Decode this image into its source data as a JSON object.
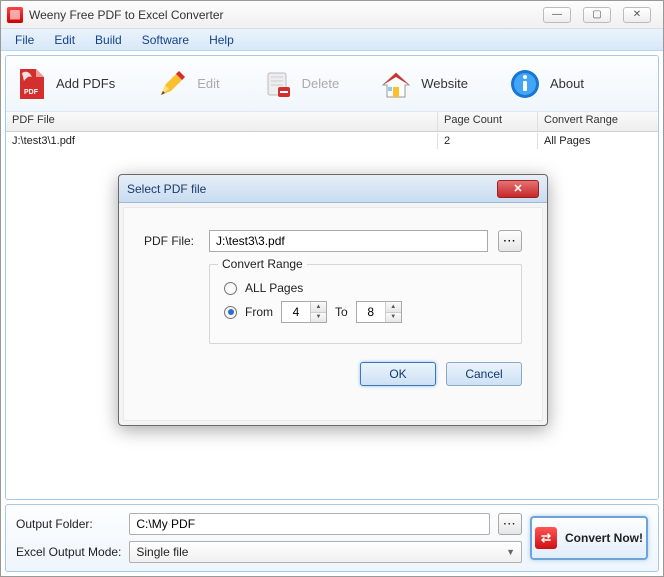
{
  "window": {
    "title": "Weeny Free PDF to Excel Converter",
    "controls": {
      "min": "—",
      "max": "▢",
      "close": "✕"
    }
  },
  "menubar": [
    "File",
    "Edit",
    "Build",
    "Software",
    "Help"
  ],
  "toolbar": {
    "add": "Add PDFs",
    "edit": "Edit",
    "delete": "Delete",
    "website": "Website",
    "about": "About"
  },
  "table": {
    "headers": {
      "file": "PDF File",
      "count": "Page Count",
      "range": "Convert Range"
    },
    "rows": [
      {
        "file": "J:\\test3\\1.pdf",
        "count": "2",
        "range": "All Pages"
      }
    ]
  },
  "bottom": {
    "output_label": "Output Folder:",
    "output_value": "C:\\My PDF",
    "mode_label": "Excel Output Mode:",
    "mode_value": "Single file",
    "convert": "Convert Now!"
  },
  "dialog": {
    "title": "Select PDF file",
    "file_label": "PDF File:",
    "file_value": "J:\\test3\\3.pdf",
    "range_legend": "Convert Range",
    "all_label": "ALL Pages",
    "from_label": "From",
    "to_label": "To",
    "from_value": "4",
    "to_value": "8",
    "ok": "OK",
    "cancel": "Cancel"
  }
}
